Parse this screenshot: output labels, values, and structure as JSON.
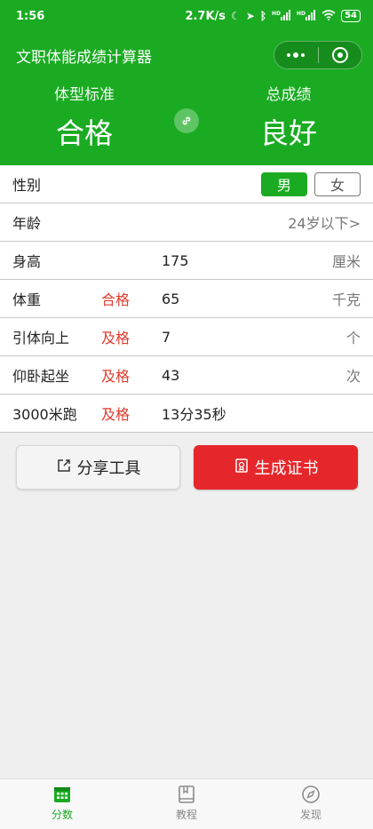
{
  "status_bar": {
    "time": "1:56",
    "net_speed": "2.7K/s",
    "signal1": "HD",
    "signal2": "HD",
    "battery": "54"
  },
  "app": {
    "title": "文职体能成绩计算器"
  },
  "summary": {
    "body_label": "体型标准",
    "body_value": "合格",
    "total_label": "总成绩",
    "total_value": "良好"
  },
  "rows": {
    "gender": {
      "label": "性别",
      "male": "男",
      "female": "女",
      "selected": "男"
    },
    "age": {
      "label": "年龄",
      "value": "24岁以下>"
    },
    "height": {
      "label": "身高",
      "value": "175",
      "unit": "厘米"
    },
    "weight": {
      "label": "体重",
      "status": "合格",
      "value": "65",
      "unit": "千克"
    },
    "pullup": {
      "label": "引体向上",
      "status": "及格",
      "value": "7",
      "unit": "个"
    },
    "situp": {
      "label": "仰卧起坐",
      "status": "及格",
      "value": "43",
      "unit": "次"
    },
    "run": {
      "label": "3000米跑",
      "status": "及格",
      "value": "13分35秒"
    }
  },
  "actions": {
    "share": "分享工具",
    "certificate": "生成证书"
  },
  "tabs": [
    {
      "label": "分数",
      "icon": "calendar-icon",
      "active": true
    },
    {
      "label": "教程",
      "icon": "book-icon",
      "active": false
    },
    {
      "label": "发现",
      "icon": "compass-icon",
      "active": false
    }
  ],
  "colors": {
    "brand": "#1aab22",
    "danger": "#e5272b",
    "status_text": "#e03c2c"
  }
}
